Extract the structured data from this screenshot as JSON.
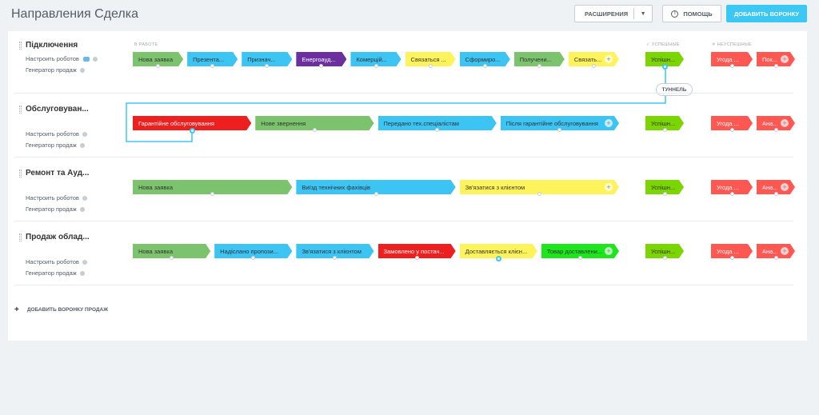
{
  "header": {
    "title": "Направления Сделка",
    "extensions_label": "РАСШИРЕНИЯ",
    "help_label": "ПОМОЩЬ",
    "add_funnel_label": "ДОБАВИТЬ ВОРОНКУ"
  },
  "columns": {
    "in_work": "В РАБОТЕ",
    "success": "✓ УСПЕШНЫЕ",
    "fail": "✕ НЕУСПЕШНЫЕ"
  },
  "tunnel_label": "ТУННЕЛЬ",
  "add_sales_funnel_label": "ДОБАВИТЬ ВОРОНКУ ПРОДАЖ",
  "funnels": [
    {
      "name": "Підключення",
      "robots": "Настроить роботов",
      "generator": "Генератор продаж",
      "stages": [
        {
          "label": "Нова заявка",
          "color": "#7bc36c"
        },
        {
          "label": "Презента...",
          "color": "#3cc4f3"
        },
        {
          "label": "Признач...",
          "color": "#3cc4f3"
        },
        {
          "label": "Енергоауд...",
          "color": "#6b2fa0"
        },
        {
          "label": "Комерцій...",
          "color": "#3cc4f3"
        },
        {
          "label": "Связаться ...",
          "color": "#fff35c"
        },
        {
          "label": "Сформиро...",
          "color": "#3cc4f3"
        },
        {
          "label": "Получени...",
          "color": "#7bc36c"
        },
        {
          "label": "Связать...",
          "color": "#fff35c"
        }
      ],
      "success": "Успішн...",
      "fails": [
        "Угода ...",
        "Пок..."
      ]
    },
    {
      "name": "Обслуговуван...",
      "robots": "Настроить роботов",
      "generator": "Генератор продаж",
      "stages": [
        {
          "label": "Гарантійне обслуговування",
          "color": "#ee1f1f"
        },
        {
          "label": "Нове звернення",
          "color": "#7bc36c"
        },
        {
          "label": "Передано тех.спеціалістам",
          "color": "#3cc4f3"
        },
        {
          "label": "Після гарантійне обслуговування",
          "color": "#3cc4f3"
        }
      ],
      "success": "Успішн...",
      "fails": [
        "Угода ...",
        "Ана..."
      ]
    },
    {
      "name": "Ремонт та Ауд...",
      "robots": "Настроить роботов",
      "generator": "Генератор продаж",
      "stages": [
        {
          "label": "Нова заявка",
          "color": "#7bc36c"
        },
        {
          "label": "Виїзд технічних фахівців",
          "color": "#3cc4f3"
        },
        {
          "label": "Зв'язатися з клієнтом",
          "color": "#fff35c"
        }
      ],
      "success": "Успішн...",
      "fails": [
        "Угода ...",
        "Ана..."
      ]
    },
    {
      "name": "Продаж облад...",
      "robots": "Настроить роботов",
      "generator": "Генератор продаж",
      "stages": [
        {
          "label": "Нова заявка",
          "color": "#7bc36c"
        },
        {
          "label": "Надіслано пропози...",
          "color": "#3cc4f3"
        },
        {
          "label": "Зв'язатися з клієнтом",
          "color": "#3cc4f3"
        },
        {
          "label": "Замовлено у постач...",
          "color": "#ee1f1f"
        },
        {
          "label": "Доставляється клієн...",
          "color": "#fff35c"
        },
        {
          "label": "Товар доставлени...",
          "color": "#1de61d"
        }
      ],
      "success": "Успішн...",
      "fails": [
        "Угода ...",
        "Ана..."
      ]
    }
  ],
  "colors": {
    "success": "#7bd500",
    "fail": "#ff5752",
    "accent": "#3bc8f5"
  }
}
